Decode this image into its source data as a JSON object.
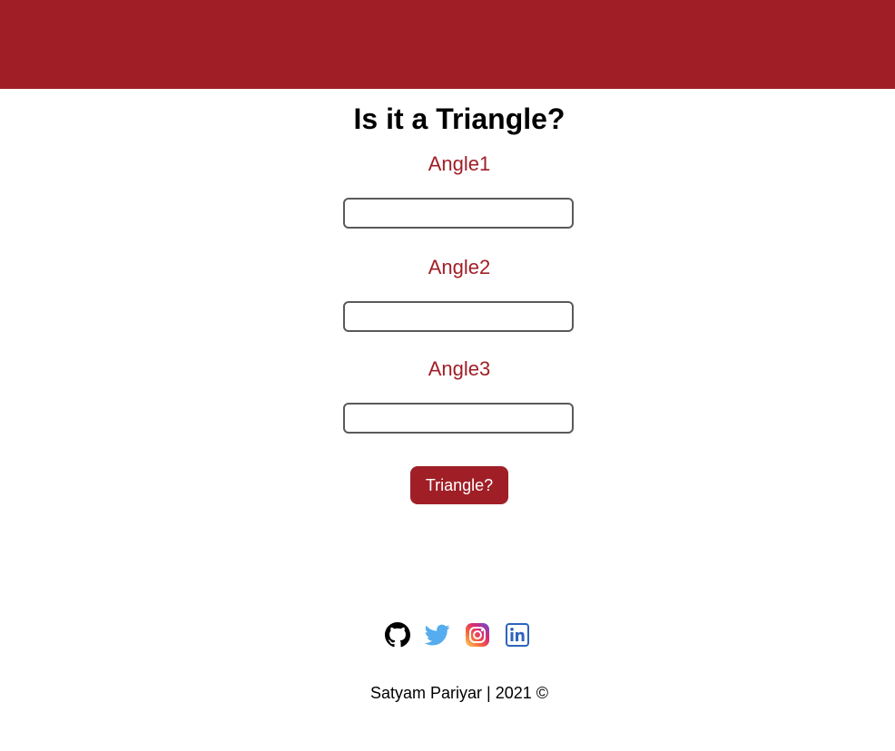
{
  "header": {
    "bar_color": "#a01f27"
  },
  "main": {
    "title": "Is it a Triangle?",
    "fields": [
      {
        "label": "Angle1",
        "value": "",
        "placeholder": ""
      },
      {
        "label": "Angle2",
        "value": "",
        "placeholder": ""
      },
      {
        "label": "Angle3",
        "value": "",
        "placeholder": ""
      }
    ],
    "submit_label": "Triangle?"
  },
  "social_links": [
    {
      "name": "github-icon"
    },
    {
      "name": "twitter-icon"
    },
    {
      "name": "instagram-icon"
    },
    {
      "name": "linkedin-icon"
    }
  ],
  "footer": {
    "text": "Satyam Pariyar | 2021 ©"
  },
  "colors": {
    "accent": "#a01f27",
    "twitter": "#55acee",
    "linkedin": "#2d64bc"
  }
}
